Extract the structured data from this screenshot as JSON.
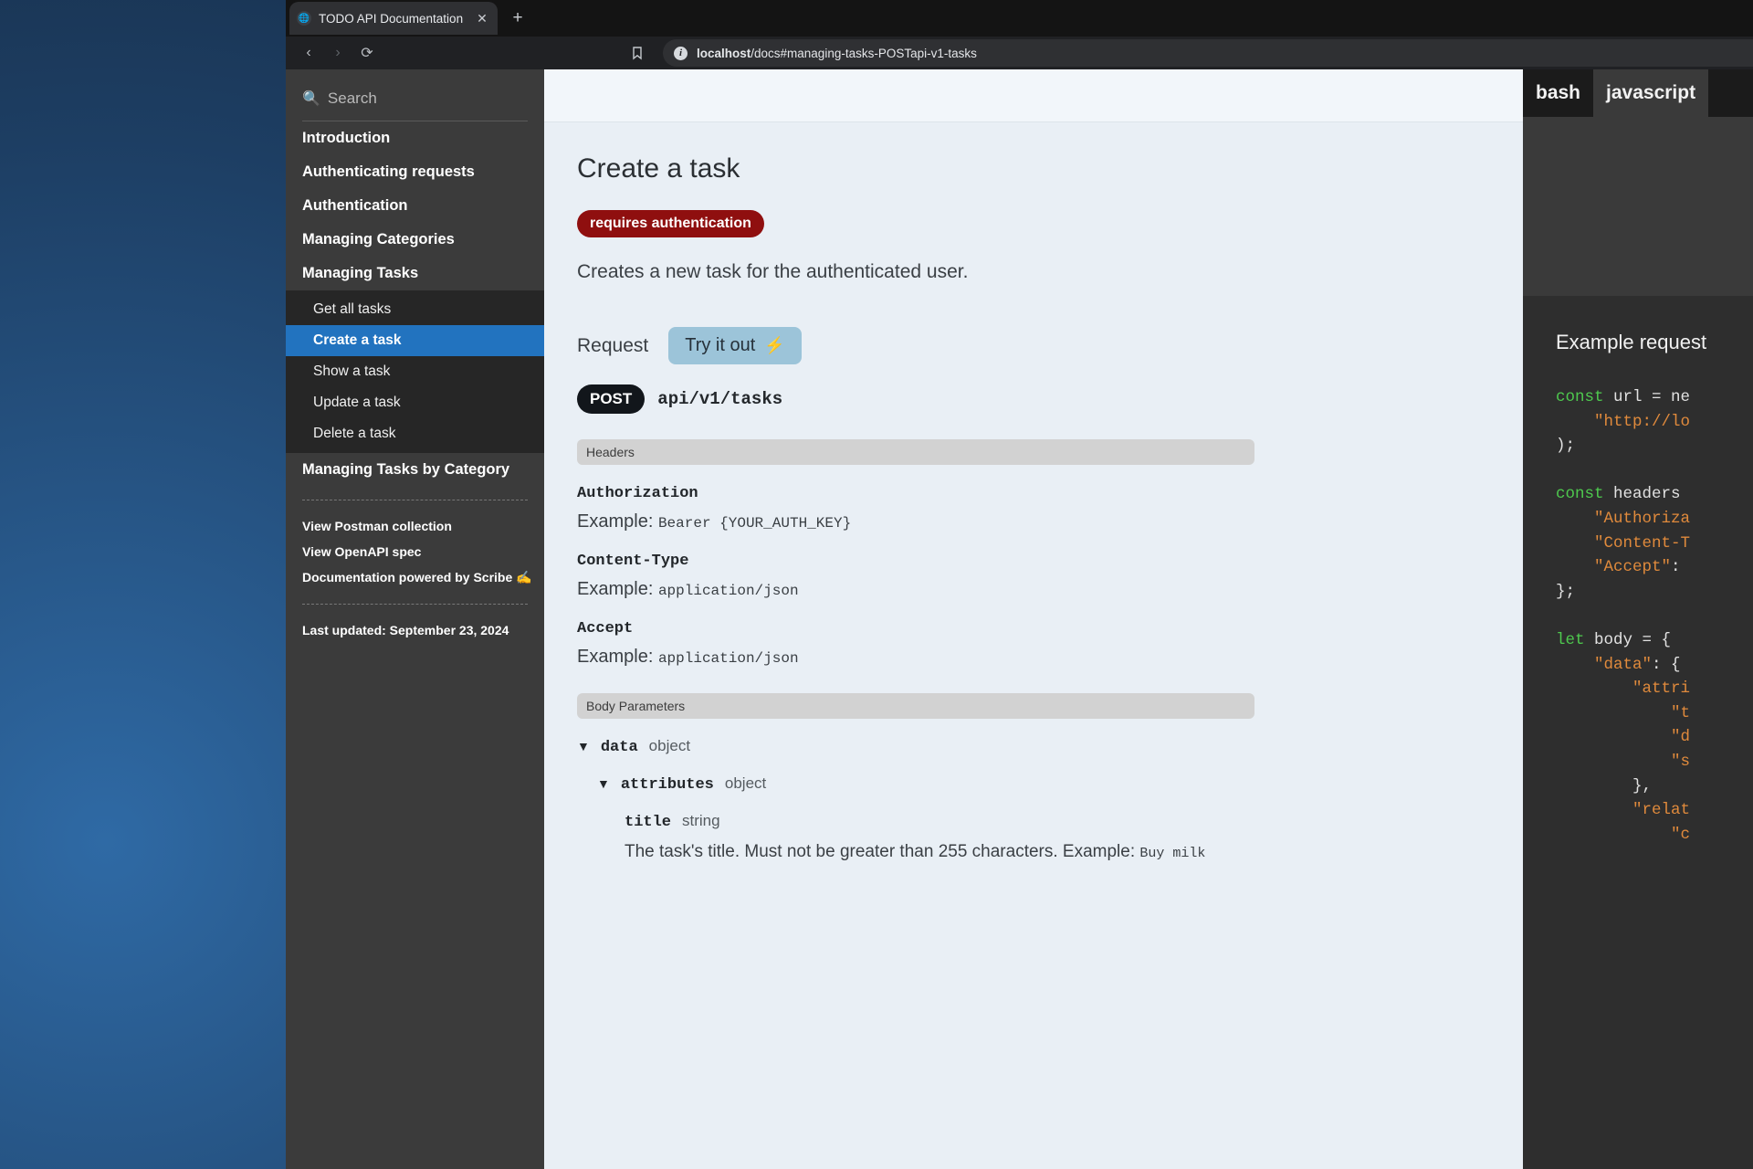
{
  "browser": {
    "tab": {
      "title": "TODO API Documentation",
      "favicon_icon": "globe-icon",
      "close_label": "✕"
    },
    "new_tab_label": "+",
    "nav": {
      "back_label": "‹",
      "forward_label": "›",
      "reload_label": "⟳",
      "bookmark_icon": "bookmark-icon"
    },
    "omnibox": {
      "info_label": "i",
      "host": "localhost",
      "path": "/docs#managing-tasks-POSTapi-v1-tasks"
    }
  },
  "sidebar": {
    "search": {
      "icon": "magnifier-icon",
      "placeholder": "Search"
    },
    "top_items": [
      {
        "label": "Introduction"
      },
      {
        "label": "Authenticating requests"
      },
      {
        "label": "Authentication"
      },
      {
        "label": "Managing Categories"
      },
      {
        "label": "Managing Tasks"
      }
    ],
    "sub_items": [
      {
        "label": "Get all tasks",
        "active": false
      },
      {
        "label": "Create a task",
        "active": true
      },
      {
        "label": "Show a task",
        "active": false
      },
      {
        "label": "Update a task",
        "active": false
      },
      {
        "label": "Delete a task",
        "active": false
      }
    ],
    "after_items": [
      {
        "label": "Managing Tasks by Category"
      }
    ],
    "footer_links": [
      {
        "label": "View Postman collection"
      },
      {
        "label": "View OpenAPI spec"
      },
      {
        "label": "Documentation powered by Scribe ✍️"
      }
    ],
    "last_updated": "Last updated: September 23, 2024"
  },
  "main": {
    "title": "Create a task",
    "auth_badge": "requires authentication",
    "description": "Creates a new task for the authenticated user.",
    "request_label": "Request",
    "try_it_out": "Try it out",
    "try_it_out_icon": "lightning-bolt-icon",
    "method": "POST",
    "endpoint": "api/v1/tasks",
    "headers_band": "Headers",
    "headers": [
      {
        "name": "Authorization",
        "example_label": "Example:",
        "example_value": "Bearer {YOUR_AUTH_KEY}"
      },
      {
        "name": "Content-Type",
        "example_label": "Example:",
        "example_value": "application/json"
      },
      {
        "name": "Accept",
        "example_label": "Example:",
        "example_value": "application/json"
      }
    ],
    "body_band": "Body Parameters",
    "body_params": [
      {
        "caret": "▼",
        "key": "data",
        "type": "object",
        "level": 0
      },
      {
        "caret": "▼",
        "key": "attributes",
        "type": "object",
        "level": 1
      },
      {
        "caret": "",
        "key": "title",
        "type": "string",
        "level": 2
      }
    ],
    "title_param_desc": "The task's title. Must not be greater than 255 characters. Example:",
    "title_param_example": "Buy milk"
  },
  "code_panel": {
    "tabs": [
      {
        "label": "bash",
        "active": false
      },
      {
        "label": "javascript",
        "active": true
      }
    ],
    "example_title": "Example request",
    "code_lines": [
      {
        "tokens": [
          {
            "t": "const",
            "c": "k"
          },
          {
            "t": " url = ne",
            "c": "p"
          }
        ]
      },
      {
        "tokens": [
          {
            "t": "    ",
            "c": "p"
          },
          {
            "t": "\"http://lo",
            "c": "s"
          }
        ]
      },
      {
        "tokens": [
          {
            "t": ");",
            "c": "p"
          }
        ]
      },
      {
        "tokens": [
          {
            "t": "",
            "c": "p"
          }
        ]
      },
      {
        "tokens": [
          {
            "t": "const",
            "c": "k"
          },
          {
            "t": " headers",
            "c": "p"
          }
        ]
      },
      {
        "tokens": [
          {
            "t": "    ",
            "c": "p"
          },
          {
            "t": "\"Authoriza",
            "c": "s"
          }
        ]
      },
      {
        "tokens": [
          {
            "t": "    ",
            "c": "p"
          },
          {
            "t": "\"Content-T",
            "c": "s"
          }
        ]
      },
      {
        "tokens": [
          {
            "t": "    ",
            "c": "p"
          },
          {
            "t": "\"Accept\"",
            "c": "s"
          },
          {
            "t": ":",
            "c": "p"
          }
        ]
      },
      {
        "tokens": [
          {
            "t": "};",
            "c": "p"
          }
        ]
      },
      {
        "tokens": [
          {
            "t": "",
            "c": "p"
          }
        ]
      },
      {
        "tokens": [
          {
            "t": "let",
            "c": "k"
          },
          {
            "t": " body = {",
            "c": "p"
          }
        ]
      },
      {
        "tokens": [
          {
            "t": "    ",
            "c": "p"
          },
          {
            "t": "\"data\"",
            "c": "s"
          },
          {
            "t": ": {",
            "c": "p"
          }
        ]
      },
      {
        "tokens": [
          {
            "t": "        ",
            "c": "p"
          },
          {
            "t": "\"attri",
            "c": "s"
          }
        ]
      },
      {
        "tokens": [
          {
            "t": "            ",
            "c": "p"
          },
          {
            "t": "\"t",
            "c": "s"
          }
        ]
      },
      {
        "tokens": [
          {
            "t": "            ",
            "c": "p"
          },
          {
            "t": "\"d",
            "c": "s"
          }
        ]
      },
      {
        "tokens": [
          {
            "t": "            ",
            "c": "p"
          },
          {
            "t": "\"s",
            "c": "s"
          }
        ]
      },
      {
        "tokens": [
          {
            "t": "        },",
            "c": "p"
          }
        ]
      },
      {
        "tokens": [
          {
            "t": "        ",
            "c": "p"
          },
          {
            "t": "\"relat",
            "c": "s"
          }
        ]
      },
      {
        "tokens": [
          {
            "t": "            ",
            "c": "p"
          },
          {
            "t": "\"c",
            "c": "s"
          }
        ]
      },
      {
        "tokens": [
          {
            "t": "",
            "c": "p"
          }
        ]
      },
      {
        "tokens": [
          {
            "t": "                      }",
            "c": "p"
          }
        ]
      }
    ]
  }
}
